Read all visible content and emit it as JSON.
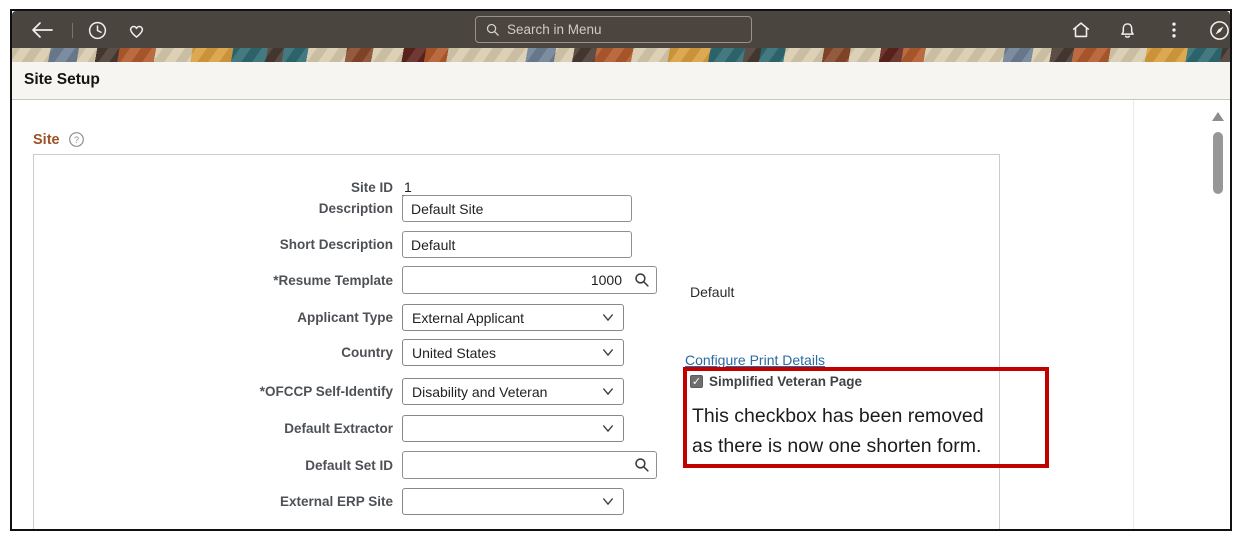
{
  "header": {
    "search": {
      "placeholder": "Search in Menu"
    }
  },
  "page": {
    "title": "Site Setup"
  },
  "section": {
    "title": "Site"
  },
  "form": {
    "fields": [
      {
        "label": "Site ID",
        "value": "1",
        "type": "readonly"
      },
      {
        "label": "Description",
        "value": "Default Site",
        "type": "text"
      },
      {
        "label": "Short Description",
        "value": "Default",
        "type": "text"
      },
      {
        "label": "*Resume Template",
        "value": "1000",
        "type": "lookup"
      },
      {
        "label": "Applicant Type",
        "value": "External Applicant",
        "type": "select"
      },
      {
        "label": "Country",
        "value": "United States",
        "type": "select"
      },
      {
        "label": "*OFCCP Self-Identify",
        "value": "Disability and Veteran",
        "type": "select"
      },
      {
        "label": "Default Extractor",
        "value": "",
        "type": "select"
      },
      {
        "label": "Default Set ID",
        "value": "",
        "type": "lookup"
      },
      {
        "label": "External ERP Site",
        "value": "",
        "type": "select"
      }
    ]
  },
  "right_panel": {
    "resume_template_descr": "Default",
    "print_link": "Configure Print Details",
    "checkbox": {
      "label": "Simplified Veteran Page",
      "checked": "checked"
    }
  },
  "annotation": {
    "line1": "This checkbox has been removed",
    "line2": "as there is now one shorten form."
  },
  "icons": {
    "check": "✓"
  },
  "colors": {
    "header_bg": "#4b453f",
    "section_title": "#9e5226",
    "link": "#2a6aa0",
    "annotation_border": "#c10000"
  }
}
